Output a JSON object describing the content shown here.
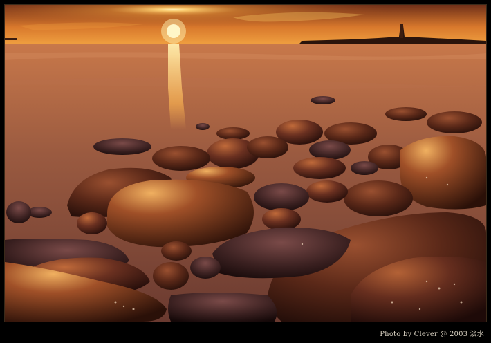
{
  "photo": {
    "credit": "Photo by Clever @ 2003 淡水"
  },
  "colors": {
    "sky_top": "#7a3a1c",
    "sky_glow": "#f7b240",
    "sun": "#fff6c8",
    "sea": "#8a5a44",
    "rock_dark": "#2a1410",
    "rock_light": "#8a4a2c"
  }
}
